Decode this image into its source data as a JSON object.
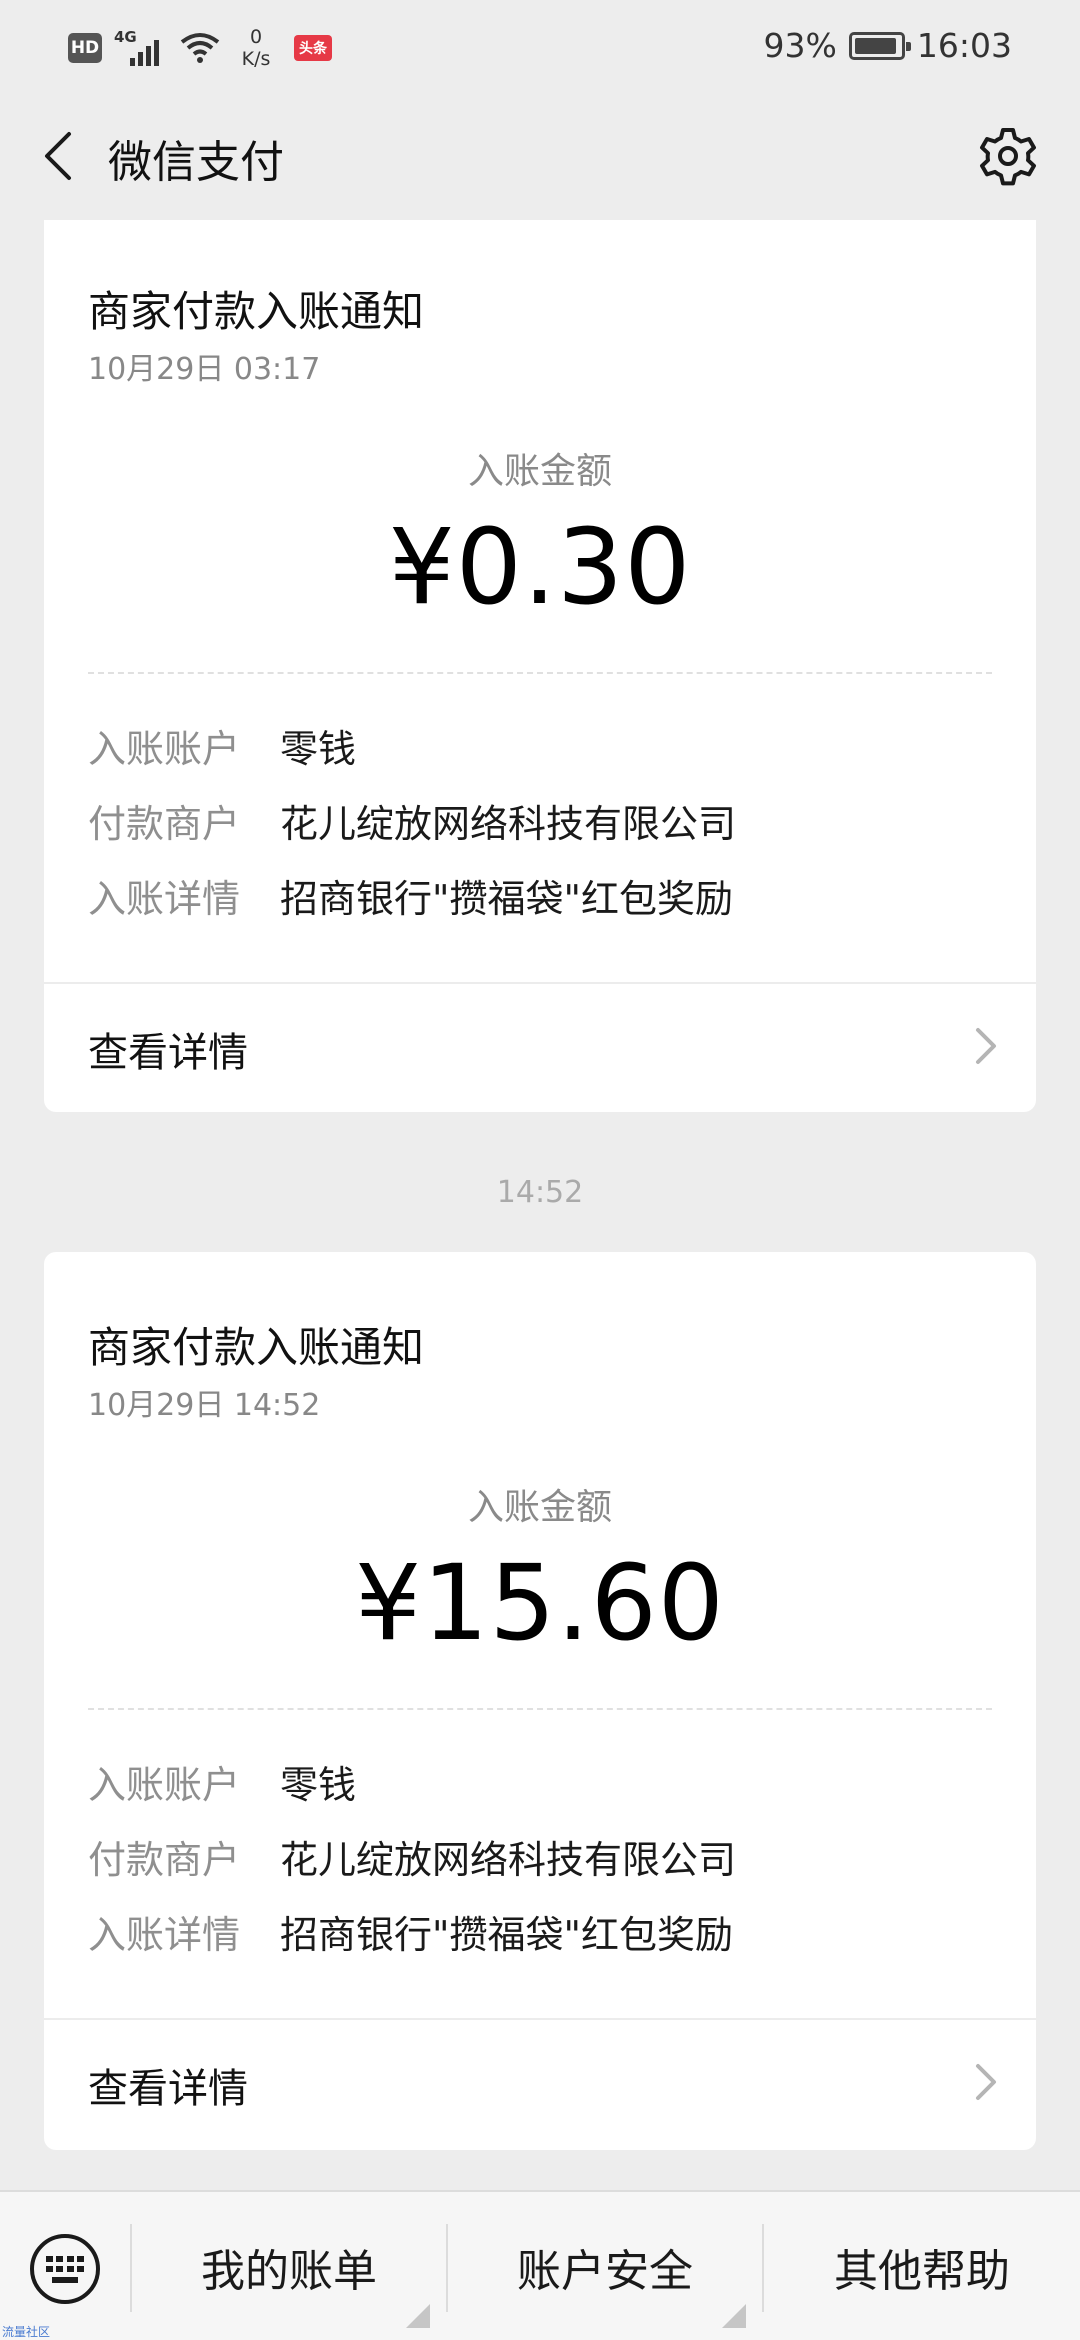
{
  "status_bar": {
    "hd": "HD",
    "network": "4G",
    "net_speed_value": "0",
    "net_speed_unit": "K/s",
    "app_badge": "头条",
    "battery_percent": "93%",
    "battery_level": 0.93,
    "time": "16:03"
  },
  "nav": {
    "title": "微信支付",
    "back_icon": "chevron-left-icon",
    "settings_icon": "gear-icon"
  },
  "cards": [
    {
      "title": "商家付款入账通知",
      "date": "10月29日  03:17",
      "amount_label": "入账金额",
      "amount": "¥0.30",
      "rows": [
        {
          "key": "入账账户",
          "value": "零钱"
        },
        {
          "key": "付款商户",
          "value": "花儿绽放网络科技有限公司"
        },
        {
          "key": "入账详情",
          "value": "招商银行\"攒福袋\"红包奖励"
        }
      ],
      "more_label": "查看详情"
    },
    {
      "title": "商家付款入账通知",
      "date": "10月29日  14:52",
      "amount_label": "入账金额",
      "amount": "¥15.60",
      "rows": [
        {
          "key": "入账账户",
          "value": "零钱"
        },
        {
          "key": "付款商户",
          "value": "花儿绽放网络科技有限公司"
        },
        {
          "key": "入账详情",
          "value": "招商银行\"攒福袋\"红包奖励"
        }
      ],
      "more_label": "查看详情"
    }
  ],
  "time_separator": "14:52",
  "bottom_menu": {
    "keyboard_icon": "keyboard-icon",
    "items": [
      "我的账单",
      "账户安全",
      "其他帮助"
    ]
  },
  "watermark": "流量社区"
}
